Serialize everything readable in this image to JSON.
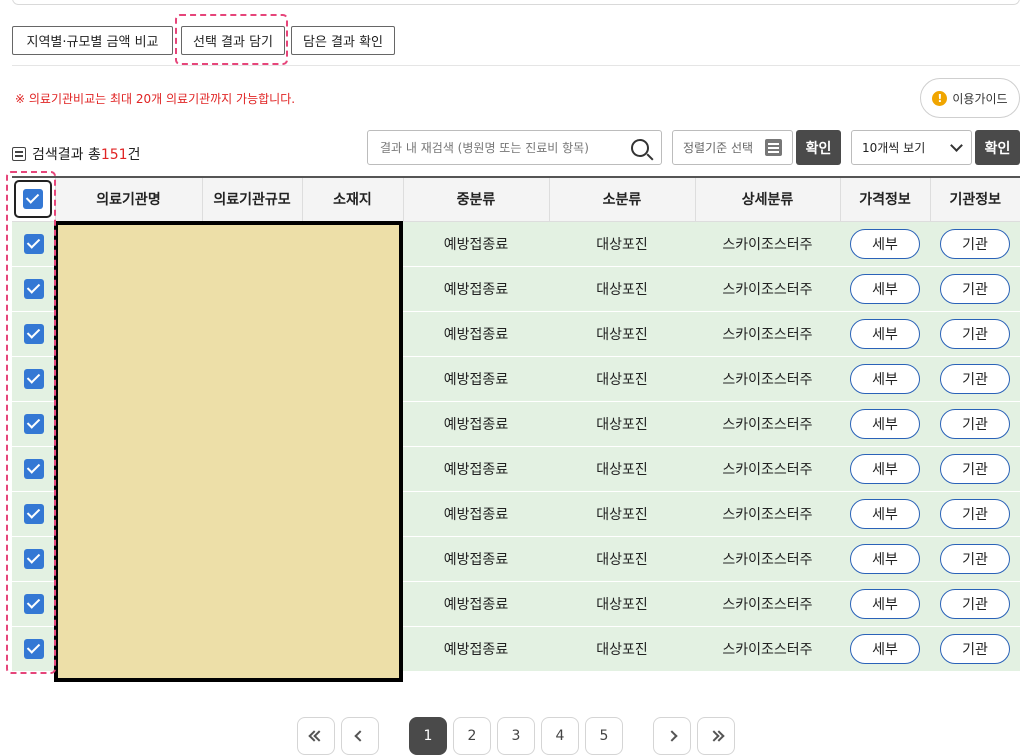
{
  "toolbar": {
    "compare_label": "지역별·규모별 금액 비교",
    "save_selected_label": "선택 결과 담기",
    "view_saved_label": "담은 결과 확인"
  },
  "notice": "※ 의료기관비교는 최대 20개 의료기관까지 가능합니다.",
  "guide_label": "이용가이드",
  "results": {
    "prefix": "검색결과 총",
    "count": "151",
    "suffix": "건"
  },
  "search": {
    "placeholder": "결과 내 재검색 (병원명 또는 진료비 항목)"
  },
  "sort": {
    "label": "정렬기준 선택"
  },
  "confirm_label": "확인",
  "per_page": {
    "selected": "10개씩 보기"
  },
  "table": {
    "headers": [
      "의료기관명",
      "의료기관규모",
      "소재지",
      "중분류",
      "소분류",
      "상세분류",
      "가격정보",
      "기관정보"
    ],
    "rows": [
      {
        "mid": "예방접종료",
        "small": "대상포진",
        "detail": "스카이조스터주",
        "price_btn": "세부",
        "org_btn": "기관"
      },
      {
        "mid": "예방접종료",
        "small": "대상포진",
        "detail": "스카이조스터주",
        "price_btn": "세부",
        "org_btn": "기관"
      },
      {
        "mid": "예방접종료",
        "small": "대상포진",
        "detail": "스카이조스터주",
        "price_btn": "세부",
        "org_btn": "기관"
      },
      {
        "mid": "예방접종료",
        "small": "대상포진",
        "detail": "스카이조스터주",
        "price_btn": "세부",
        "org_btn": "기관"
      },
      {
        "mid": "예방접종료",
        "small": "대상포진",
        "detail": "스카이조스터주",
        "price_btn": "세부",
        "org_btn": "기관"
      },
      {
        "mid": "예방접종료",
        "small": "대상포진",
        "detail": "스카이조스터주",
        "price_btn": "세부",
        "org_btn": "기관"
      },
      {
        "mid": "예방접종료",
        "small": "대상포진",
        "detail": "스카이조스터주",
        "price_btn": "세부",
        "org_btn": "기관"
      },
      {
        "mid": "예방접종료",
        "small": "대상포진",
        "detail": "스카이조스터주",
        "price_btn": "세부",
        "org_btn": "기관"
      },
      {
        "mid": "예방접종료",
        "small": "대상포진",
        "detail": "스카이조스터주",
        "price_btn": "세부",
        "org_btn": "기관"
      },
      {
        "mid": "예방접종료",
        "small": "대상포진",
        "detail": "스카이조스터주",
        "price_btn": "세부",
        "org_btn": "기관"
      }
    ]
  },
  "pagination": {
    "pages": [
      "1",
      "2",
      "3",
      "4",
      "5"
    ],
    "current": "1"
  },
  "colors": {
    "accent": "#3478d4",
    "row_bg": "#e3f1e2",
    "highlight": "#e6457a",
    "notice": "#e02424",
    "redaction": "#eddfa8"
  }
}
